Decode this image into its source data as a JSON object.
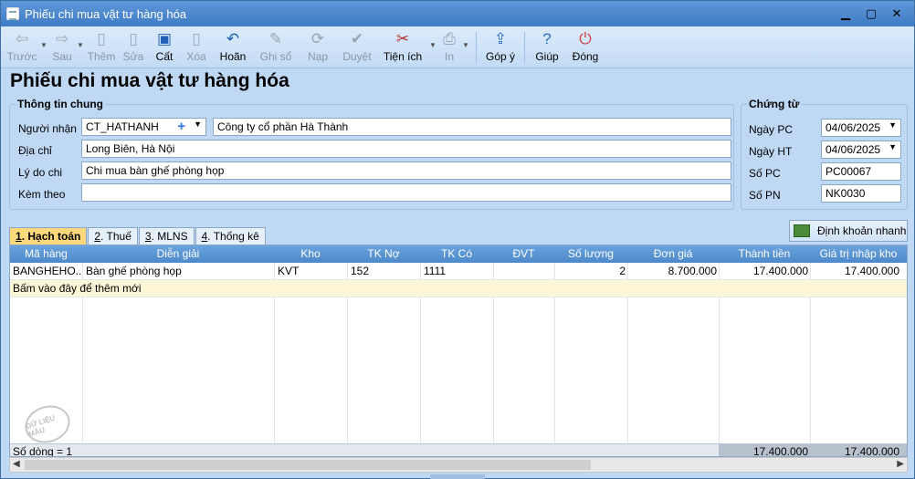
{
  "window": {
    "title": "Phiếu chi mua vật tư hàng hóa"
  },
  "toolbar": {
    "prev": "Trước",
    "next": "Sau",
    "add": "Thêm",
    "edit": "Sửa",
    "save": "Cất",
    "delete": "Xóa",
    "undo": "Hoãn",
    "post": "Ghi sổ",
    "reload": "Nạp",
    "approve": "Duyệt",
    "utilities": "Tiện ích",
    "print": "In",
    "feedback": "Góp ý",
    "help": "Giúp",
    "close": "Đóng"
  },
  "page": {
    "title": "Phiếu chi mua vật tư hàng hóa"
  },
  "general": {
    "section_title": "Thông tin chung",
    "recipient_label": "Người nhận",
    "recipient_code": "CT_HATHANH",
    "recipient_name": "Công ty cổ phần Hà Thành",
    "address_label": "Địa chỉ",
    "address": "Long Biên, Hà Nội",
    "reason_label": "Lý do chi",
    "reason": "Chi mua bàn ghế phòng họp",
    "attach_label": "Kèm theo",
    "attach": ""
  },
  "voucher": {
    "section_title": "Chứng từ",
    "date_pc_label": "Ngày PC",
    "date_pc": "04/06/2025",
    "date_ht_label": "Ngày HT",
    "date_ht": "04/06/2025",
    "no_pc_label": "Số PC",
    "no_pc": "PC00067",
    "no_pn_label": "Số PN",
    "no_pn": "NK0030"
  },
  "tabs": [
    {
      "num": "1",
      "label": ". Hạch toán"
    },
    {
      "num": "2",
      "label": ". Thuế"
    },
    {
      "num": "3",
      "label": ". MLNS"
    },
    {
      "num": "4",
      "label": ". Thống kê"
    }
  ],
  "quick_entry": "Định khoản nhanh",
  "grid": {
    "columns": [
      "Mã hàng",
      "Diễn giải",
      "Kho",
      "TK Nợ",
      "TK Có",
      "ĐVT",
      "Số lượng",
      "Đơn giá",
      "Thành tiền",
      "Giá trị nhập kho"
    ],
    "row": {
      "item_code": "BANGHEHO...",
      "description": "Bàn ghế phòng họp",
      "warehouse": "KVT",
      "debit": "152",
      "credit": "1111",
      "unit": "",
      "quantity": "2",
      "unit_price": "8.700.000",
      "amount": "17.400.000",
      "stock_value": "17.400.000"
    },
    "new_row_hint": "Bấm vào đây để thêm mới",
    "row_count": "Số dòng = 1",
    "total_amount": "17.400.000",
    "total_stock_value": "17.400.000"
  },
  "watermark": "DỮ LIỆU MẪU"
}
